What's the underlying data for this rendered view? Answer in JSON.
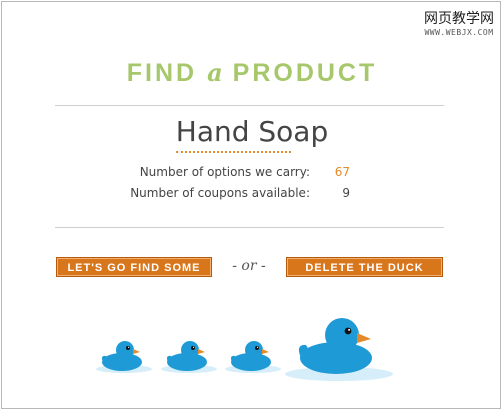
{
  "watermark": {
    "title": "网页教学网",
    "url": "WWW.WEBJX.COM"
  },
  "heading": {
    "word1": "FIND",
    "word2": "a",
    "word3": "PRODUCT"
  },
  "product": {
    "name": "Hand Soap"
  },
  "stats": [
    {
      "label": "Number of options we carry:",
      "value": "67"
    },
    {
      "label": "Number of coupons available:",
      "value": "9"
    }
  ],
  "actions": {
    "find_label": "LET'S GO FIND SOME",
    "or_label": "- or -",
    "delete_label": "DELETE THE DUCK"
  },
  "colors": {
    "heading": "#a6c86a",
    "accent_orange": "#d8761c",
    "duck_blue": "#1e9ad6",
    "water": "#d6eefa"
  },
  "ducks": {
    "icon": "rubber-duck-icon",
    "small_count": 3,
    "large_count": 1
  }
}
